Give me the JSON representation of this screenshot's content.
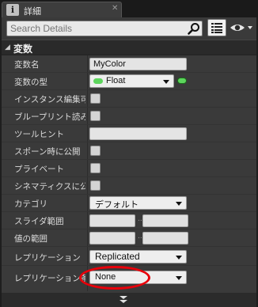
{
  "tab": {
    "icon": "info-icon",
    "icon_glyph": "i",
    "title": "詳細",
    "close": "✕"
  },
  "search": {
    "placeholder": "Search Details",
    "value": ""
  },
  "section": {
    "title": "変数",
    "arrow": "◀"
  },
  "rows": [
    {
      "key": "variable_name",
      "label": "変数名",
      "type": "text",
      "value": "MyColor"
    },
    {
      "key": "variable_type",
      "label": "変数の型",
      "type": "type-dropdown",
      "value": "Float",
      "pill_color": "#5dd55d"
    },
    {
      "key": "instance_editable",
      "label": "インスタンス編集可",
      "type": "checkbox",
      "checked": false
    },
    {
      "key": "blueprint_readonly",
      "label": "ブループリント読み",
      "type": "checkbox",
      "checked": false
    },
    {
      "key": "tooltip",
      "label": "ツールヒント",
      "type": "text",
      "value": ""
    },
    {
      "key": "expose_on_spawn",
      "label": "スポーン時に公開",
      "type": "checkbox",
      "checked": false
    },
    {
      "key": "private",
      "label": "プライベート",
      "type": "checkbox",
      "checked": false
    },
    {
      "key": "expose_to_cinematics",
      "label": "シネマティクスに公",
      "type": "checkbox",
      "checked": false
    },
    {
      "key": "category",
      "label": "カテゴリ",
      "type": "dropdown",
      "value": "デフォルト"
    },
    {
      "key": "slider_range",
      "label": "スライダ範囲",
      "type": "range",
      "min": "",
      "max": "",
      "separator": ".."
    },
    {
      "key": "value_range",
      "label": "値の範囲",
      "type": "range",
      "min": "",
      "max": "",
      "separator": ".."
    },
    {
      "key": "replication",
      "label": "レプリケーション",
      "type": "dropdown",
      "value": "Replicated",
      "highlighted": true
    },
    {
      "key": "replication_condition",
      "label": "レプリケーション条",
      "type": "dropdown",
      "value": "None"
    }
  ],
  "colors": {
    "panel_bg": "#3a3a3a",
    "highlight": "#e8000a",
    "float_pin": "#5dd55d"
  },
  "icons": {
    "search": "search-icon",
    "view": "list-view-icon",
    "eye": "eye-icon",
    "more": "chevron-down-icon"
  }
}
